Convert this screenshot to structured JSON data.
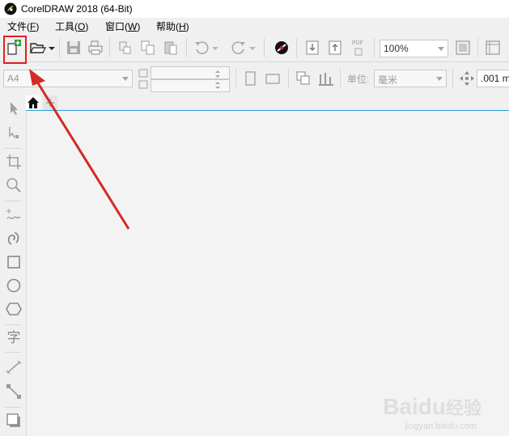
{
  "window": {
    "title": "CorelDRAW 2018 (64-Bit)"
  },
  "menu": [
    {
      "label": "文件(",
      "key": "F",
      "suffix": ")"
    },
    {
      "label": "工具(",
      "key": "O",
      "suffix": ")"
    },
    {
      "label": "窗口(",
      "key": "W",
      "suffix": ")"
    },
    {
      "label": "帮助(",
      "key": "H",
      "suffix": ")"
    }
  ],
  "toolbar": {
    "zoom_value": "100%",
    "pdf_label": "PDF"
  },
  "property_bar": {
    "page_size": "A4",
    "unit_label": "单位:",
    "unit_value": "毫米",
    "nudge_value": ".001 m"
  },
  "toolbox": {
    "text_tool_glyph": "字"
  },
  "watermark": {
    "brand": "Bai",
    "brand2": "du",
    "cn": "经验",
    "url": "jingyan.baidu.com"
  },
  "colors": {
    "highlight": "#e0221f",
    "accent_line": "#2c9fe0"
  }
}
